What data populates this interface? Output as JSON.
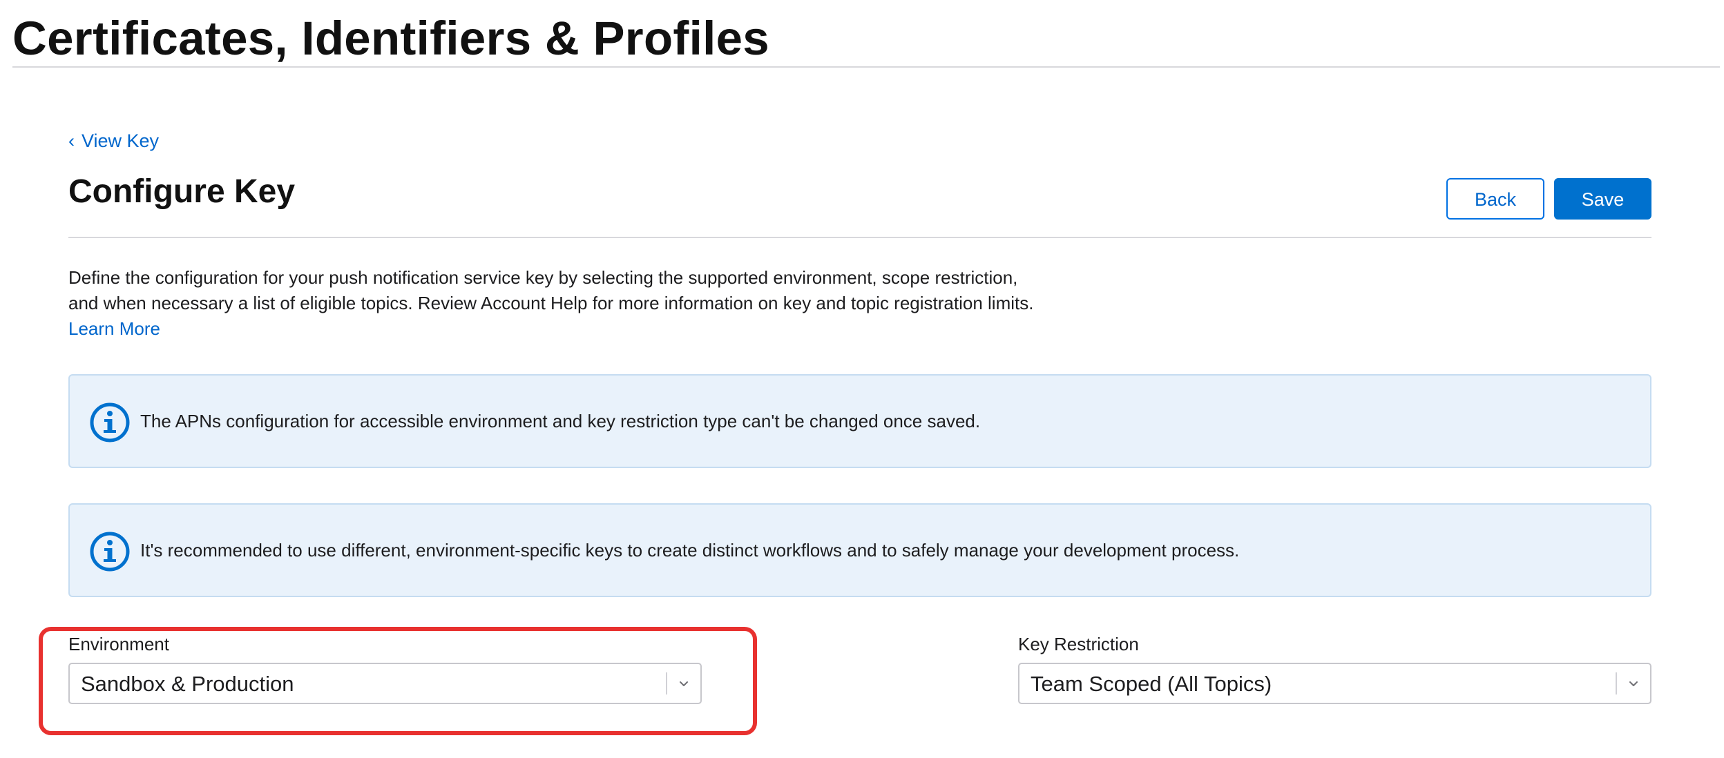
{
  "header": {
    "title": "Certificates, Identifiers & Profiles"
  },
  "breadcrumb": {
    "chevron": "‹",
    "label": "View Key"
  },
  "section": {
    "title": "Configure Key",
    "back_label": "Back",
    "save_label": "Save"
  },
  "description": {
    "text": "Define the configuration for your push notification service key by selecting the supported environment, scope restriction, and when necessary a list of eligible topics. Review Account Help for more information on key and topic registration limits. ",
    "link_label": "Learn More"
  },
  "notices": [
    {
      "icon": "info-icon",
      "text": "The APNs configuration for accessible environment and key restriction type can't be changed once saved."
    },
    {
      "icon": "info-icon",
      "text": "It's recommended to use different, environment-specific keys to create distinct workflows and to safely manage your development process."
    }
  ],
  "fields": {
    "environment": {
      "label": "Environment",
      "value": "Sandbox & Production"
    },
    "key_restriction": {
      "label": "Key Restriction",
      "value": "Team Scoped (All Topics)"
    }
  },
  "colors": {
    "accent": "#0071ce",
    "link": "#0066cc",
    "notice_bg": "#e9f2fb",
    "highlight": "#e8312f"
  }
}
